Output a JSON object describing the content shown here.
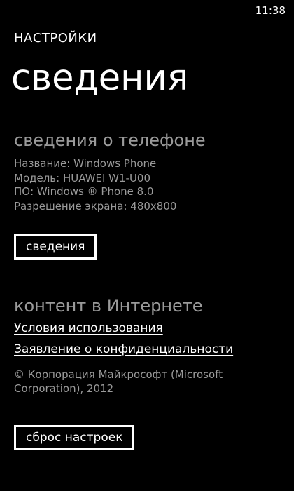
{
  "status_bar": {
    "time": "11:38"
  },
  "header": {
    "app_title": "НАСТРОЙКИ",
    "page_title": "сведения"
  },
  "phone_info": {
    "heading": "сведения о телефоне",
    "name": "Название: Windows Phone",
    "model": "Модель: HUAWEI W1-U00",
    "os": "ПО: Windows ® Phone 8.0",
    "resolution": "Разрешение экрана: 480x800",
    "more_button": "сведения"
  },
  "internet_content": {
    "heading": "контент в Интернете",
    "terms_link": "Условия использования",
    "privacy_link": "Заявление о конфиденциальности",
    "copyright": "© Корпорация Майкрософт (Microsoft Corporation), 2012"
  },
  "reset_button": "сброс настроек"
}
